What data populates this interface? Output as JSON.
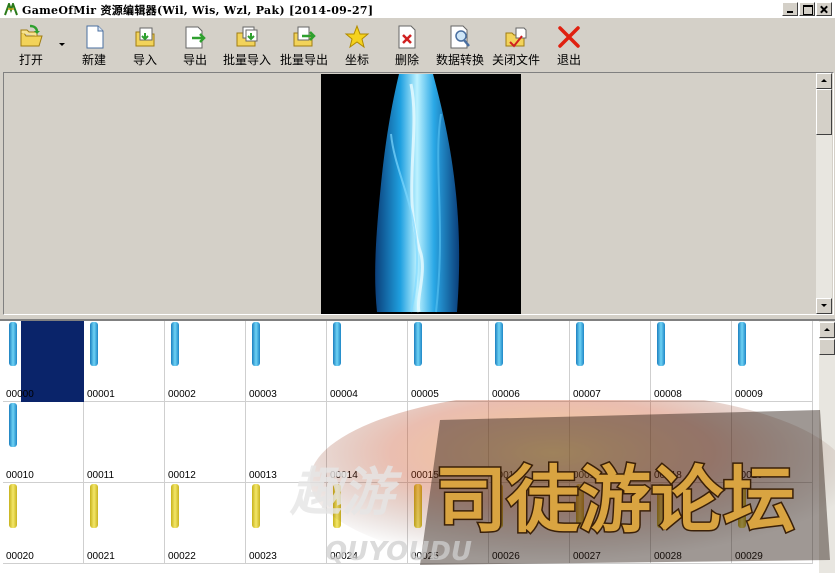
{
  "window": {
    "title": "GameOfMir 资源编辑器(Wil, Wis, Wzl, Pak) [2014-09-27]"
  },
  "toolbar": {
    "buttons": [
      {
        "label": "打开",
        "icon": "open-folder-icon"
      },
      {
        "label": "新建",
        "icon": "new-file-icon"
      },
      {
        "label": "导入",
        "icon": "import-icon"
      },
      {
        "label": "导出",
        "icon": "export-icon"
      },
      {
        "label": "批量导入",
        "icon": "batch-import-icon"
      },
      {
        "label": "批量导出",
        "icon": "batch-export-icon"
      },
      {
        "label": "坐标",
        "icon": "star-icon"
      },
      {
        "label": "删除",
        "icon": "delete-icon"
      },
      {
        "label": "数据转换",
        "icon": "convert-icon"
      },
      {
        "label": "关闭文件",
        "icon": "close-file-icon"
      },
      {
        "label": "退出",
        "icon": "exit-icon"
      }
    ]
  },
  "grid": {
    "selected_index": 0,
    "cells": [
      {
        "label": "00000",
        "sprite": "blue"
      },
      {
        "label": "00001",
        "sprite": "blue"
      },
      {
        "label": "00002",
        "sprite": "blue"
      },
      {
        "label": "00003",
        "sprite": "blue"
      },
      {
        "label": "00004",
        "sprite": "blue"
      },
      {
        "label": "00005",
        "sprite": "blue"
      },
      {
        "label": "00006",
        "sprite": "blue"
      },
      {
        "label": "00007",
        "sprite": "blue"
      },
      {
        "label": "00008",
        "sprite": "blue"
      },
      {
        "label": "00009",
        "sprite": "blue"
      },
      {
        "label": "00010",
        "sprite": "blue"
      },
      {
        "label": "00011",
        "sprite": ""
      },
      {
        "label": "00012",
        "sprite": ""
      },
      {
        "label": "00013",
        "sprite": ""
      },
      {
        "label": "00014",
        "sprite": ""
      },
      {
        "label": "00015",
        "sprite": ""
      },
      {
        "label": "00016",
        "sprite": ""
      },
      {
        "label": "00017",
        "sprite": ""
      },
      {
        "label": "00018",
        "sprite": ""
      },
      {
        "label": "00019",
        "sprite": ""
      },
      {
        "label": "00020",
        "sprite": "yellow"
      },
      {
        "label": "00021",
        "sprite": "yellow"
      },
      {
        "label": "00022",
        "sprite": "yellow"
      },
      {
        "label": "00023",
        "sprite": "yellow"
      },
      {
        "label": "00024",
        "sprite": "yellow"
      },
      {
        "label": "00025",
        "sprite": "yellow"
      },
      {
        "label": "00026",
        "sprite": "yellow"
      },
      {
        "label": "00027",
        "sprite": "yellow"
      },
      {
        "label": "00028",
        "sprite": "yellow"
      },
      {
        "label": "00029",
        "sprite": "yellow"
      }
    ]
  },
  "watermark": {
    "text_main": "司徒游论坛",
    "text_left": "趣游",
    "text_latin": "QUYOUDU"
  },
  "colors": {
    "face": "#d4d0c8",
    "selection": "#0a246a",
    "preview_bg": "#000000"
  }
}
